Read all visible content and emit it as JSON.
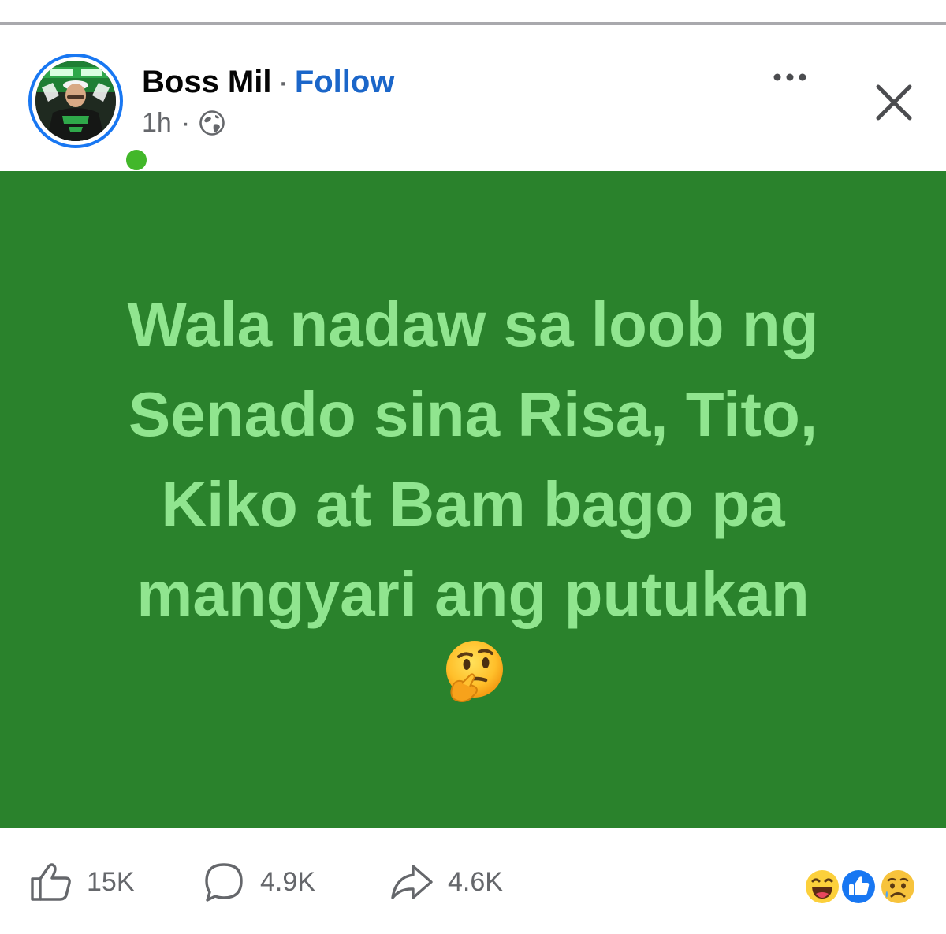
{
  "post": {
    "author": "Boss Mil",
    "separator": "·",
    "follow_label": "Follow",
    "time": "1h",
    "time_separator": "·",
    "privacy_icon": "globe-icon",
    "text": "Wala  nadaw sa loob ng\nSenado sina Risa, Tito,\nKiko at Bam bago pa\nmangyari ang putukan",
    "emoji": "thinking-face"
  },
  "header": {
    "more_icon": "more-horizontal-icon",
    "close_icon": "close-icon"
  },
  "actions": {
    "likes": "15K",
    "comments": "4.9K",
    "shares": "4.6K"
  },
  "reactions": [
    "haha",
    "like",
    "sad"
  ],
  "colors": {
    "post_background": "#2a822c",
    "post_text": "#90e58f",
    "follow": "#1b66c9",
    "online": "#42b72a",
    "avatar_ring": "#1877f2"
  }
}
